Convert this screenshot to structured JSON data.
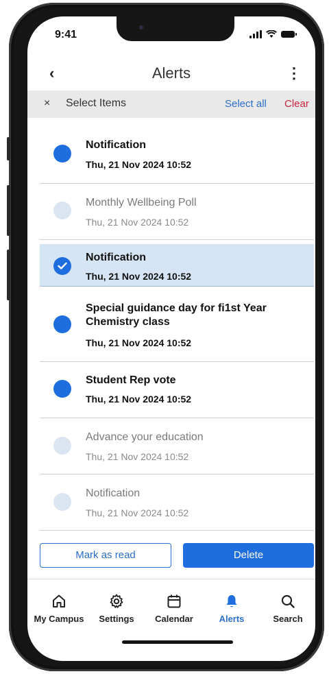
{
  "status": {
    "time": "9:41"
  },
  "header": {
    "title": "Alerts",
    "back_glyph": "‹",
    "menu_glyph": "⋮"
  },
  "selectbar": {
    "close_glyph": "×",
    "label": "Select Items",
    "select_all": "Select all",
    "clear": "Clear"
  },
  "items": [
    {
      "title": "Notification",
      "time": "Thu, 21 Nov 2024 10:52",
      "state": "unread"
    },
    {
      "title": "Monthly Wellbeing Poll",
      "time": "Thu, 21 Nov 2024 10:52",
      "state": "read"
    },
    {
      "title": "Notification",
      "time": "Thu, 21 Nov 2024 10:52",
      "state": "selected"
    },
    {
      "title": "Special guidance day for fi1st Year Chemistry class",
      "time": "Thu, 21 Nov 2024 10:52",
      "state": "unread"
    },
    {
      "title": "Student Rep vote",
      "time": "Thu, 21 Nov 2024 10:52",
      "state": "unread"
    },
    {
      "title": "Advance your education",
      "time": "Thu, 21 Nov 2024 10:52",
      "state": "read"
    },
    {
      "title": "Notification",
      "time": "Thu, 21 Nov 2024 10:52",
      "state": "read"
    }
  ],
  "actions": {
    "mark_read": "Mark as read",
    "delete": "Delete"
  },
  "tabs": [
    {
      "label": "My Campus",
      "icon": "home-icon"
    },
    {
      "label": "Settings",
      "icon": "gear-icon"
    },
    {
      "label": "Calendar",
      "icon": "calendar-icon"
    },
    {
      "label": "Alerts",
      "icon": "bell-icon",
      "active": true
    },
    {
      "label": "Search",
      "icon": "search-icon"
    }
  ],
  "colors": {
    "accent": "#1f6ee0",
    "link": "#2a6fc9",
    "danger": "#c7253e",
    "selected_bg": "#d6e5f5"
  }
}
